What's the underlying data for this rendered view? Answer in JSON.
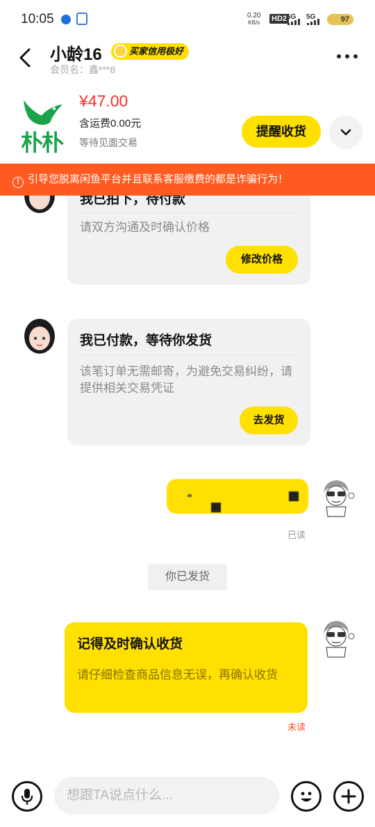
{
  "status_bar": {
    "time": "10:05",
    "net_speed": "0.20",
    "net_unit": "KB/s",
    "hd_label": "HD2",
    "sig1": "5G",
    "sig2": "5G",
    "battery": "97"
  },
  "header": {
    "title": "小龄16",
    "badge": "买家信用极好",
    "member": "会员名：鑫***8"
  },
  "product": {
    "price": "¥47.00",
    "shipping": "含运费0.00元",
    "trade": "等待见面交易",
    "logo_text": "朴朴",
    "remind_label": "提醒收货"
  },
  "warning": {
    "text": "引导您脱离闲鱼平台并且联系客服缴费的都是诈骗行为！"
  },
  "messages": {
    "card1": {
      "title": "我已拍下，待付款",
      "body": "请双方沟通及时确认价格",
      "action": "修改价格"
    },
    "card2": {
      "title": "我已付款，等待你发货",
      "body": "该笔订单无需邮寄，为避免交易纠纷，请提供相关交易凭证",
      "action": "去发货"
    },
    "blurred_read": "已读",
    "system": "你已发货",
    "card3": {
      "title": "记得及时确认收货",
      "body": "请仔细检查商品信息无误，再确认收货",
      "status": "未读"
    }
  },
  "input": {
    "placeholder": "想跟TA说点什么..."
  },
  "colors": {
    "accent": "#ffe000",
    "price": "#ff2b2b",
    "warning_bg": "#ff5a1f",
    "unread": "#ff4d1f",
    "brand_green": "#1aa34a"
  }
}
